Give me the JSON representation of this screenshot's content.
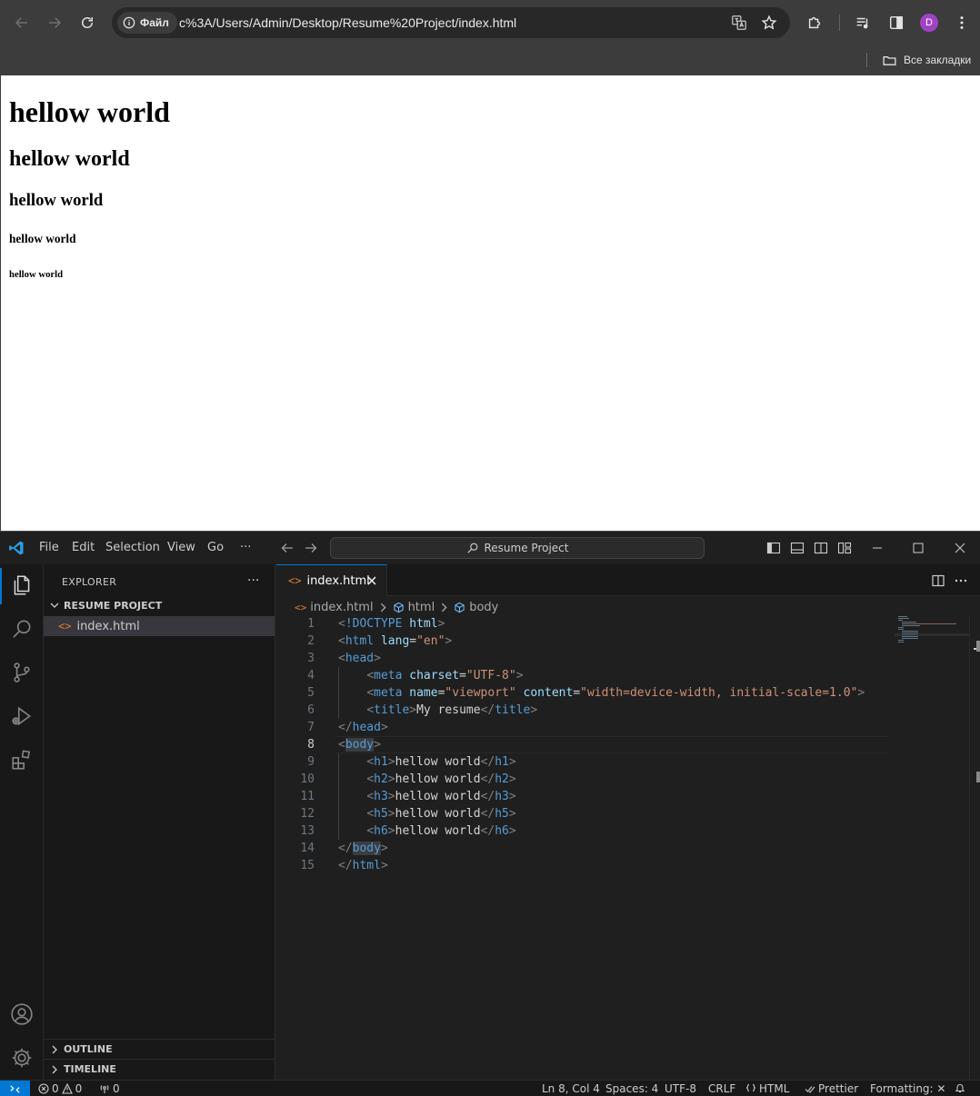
{
  "browser": {
    "site_chip": "Файл",
    "url": "c%3A/Users/Admin/Desktop/Resume%20Project/index.html",
    "profile_initial": "D",
    "bookmarks_all": "Все закладки"
  },
  "page": {
    "h1": "hellow world",
    "h2": "hellow world",
    "h3": "hellow world",
    "h5": "hellow world",
    "h6": "hellow world"
  },
  "vscode": {
    "menu": [
      "File",
      "Edit",
      "Selection",
      "View",
      "Go",
      "···"
    ],
    "search_label": "Resume Project",
    "explorer_title": "EXPLORER",
    "explorer_more": "···",
    "project_name": "RESUME PROJECT",
    "file_name": "index.html",
    "outline_label": "OUTLINE",
    "timeline_label": "TIMELINE",
    "tab_label": "index.html",
    "breadcrumb": [
      "index.html",
      "html",
      "body"
    ],
    "line_numbers": [
      "1",
      "2",
      "3",
      "4",
      "5",
      "6",
      "7",
      "8",
      "9",
      "10",
      "11",
      "12",
      "13",
      "14",
      "15"
    ],
    "active_line": 8,
    "code_lines": [
      "<!DOCTYPE html>",
      "<html lang=\"en\">",
      "<head>",
      "    <meta charset=\"UTF-8\">",
      "    <meta name=\"viewport\" content=\"width=device-width, initial-scale=1.0\">",
      "    <title>My resume</title>",
      "</head>",
      "<body>",
      "    <h1>hellow world</h1>",
      "    <h2>hellow world</h2>",
      "    <h3>hellow world</h3>",
      "    <h5>hellow world</h5>",
      "    <h6>hellow world</h6>",
      "</body>",
      "</html>"
    ],
    "status": {
      "errors": "0",
      "warnings": "0",
      "ports": "0",
      "position": "Ln 8, Col 4",
      "spaces": "Spaces: 4",
      "encoding": "UTF-8",
      "eol": "CRLF",
      "language": "HTML",
      "prettier": "Prettier",
      "formatting": "Formatting: ✕"
    }
  },
  "colors": {
    "accent": "#0078d4",
    "tag": "#569cd6",
    "attr": "#9cdcfe",
    "string": "#ce9178",
    "html_file_icon": "#e37933",
    "avatar": "#a142c4"
  }
}
